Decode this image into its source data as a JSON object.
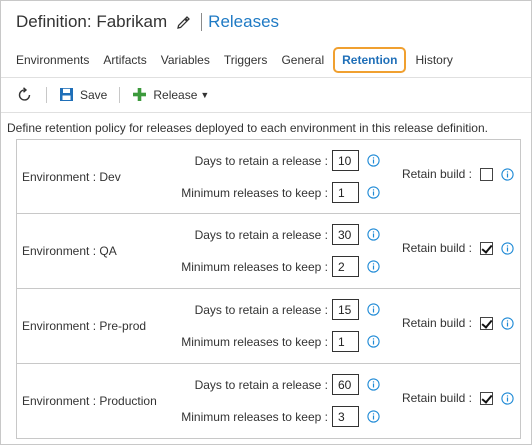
{
  "header": {
    "definition_title": "Definition: Fabrikam",
    "releases_link": "Releases"
  },
  "tabs": [
    {
      "label": "Environments",
      "active": false
    },
    {
      "label": "Artifacts",
      "active": false
    },
    {
      "label": "Variables",
      "active": false
    },
    {
      "label": "Triggers",
      "active": false
    },
    {
      "label": "General",
      "active": false
    },
    {
      "label": "Retention",
      "active": true
    },
    {
      "label": "History",
      "active": false
    }
  ],
  "toolbar": {
    "save_label": "Save",
    "release_label": "Release"
  },
  "description": "Define retention policy for releases deployed to each environment in this release definition.",
  "labels": {
    "days_to_retain": "Days to retain a release :",
    "min_releases": "Minimum releases to keep :",
    "retain_build": "Retain build :"
  },
  "environments": [
    {
      "label": "Environment : Dev",
      "days": "10",
      "min": "1",
      "retain_build": false
    },
    {
      "label": "Environment : QA",
      "days": "30",
      "min": "2",
      "retain_build": true
    },
    {
      "label": "Environment : Pre-prod",
      "days": "15",
      "min": "1",
      "retain_build": true
    },
    {
      "label": "Environment : Production",
      "days": "60",
      "min": "3",
      "retain_build": true
    }
  ],
  "colors": {
    "link": "#1f7ac4",
    "active_tab_outline": "#f0a030",
    "save_icon": "#1f6fb8",
    "add_icon": "#3c9a3c",
    "info_icon": "#1f8ad6"
  }
}
